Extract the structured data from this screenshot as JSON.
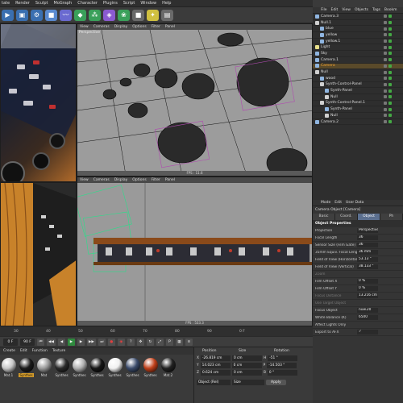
{
  "menu": [
    "tate",
    "Render",
    "Sculpt",
    "MoGraph",
    "Character",
    "Plugins",
    "Script",
    "Window",
    "Help"
  ],
  "toolbar": {
    "icons": [
      "render-icon",
      "render-region-icon",
      "render-settings-icon",
      "cube-icon",
      "spline-icon",
      "nurbs-icon",
      "array-icon",
      "deformer-icon",
      "scene-icon",
      "camera-icon",
      "light-icon",
      "display-icon"
    ]
  },
  "viewport_top": {
    "menu": [
      "View",
      "Cameras",
      "Display",
      "Options",
      "Filter",
      "Panel"
    ],
    "label": "Perspective",
    "fps": "FPS : 11.6"
  },
  "viewport_bottom": {
    "menu": [
      "View",
      "Cameras",
      "Display",
      "Options",
      "Filter",
      "Panel"
    ],
    "fps": "FPS : 533.3"
  },
  "object_manager": {
    "menu": [
      "File",
      "Edit",
      "View",
      "Objects",
      "Tags",
      "Bookm"
    ],
    "items": [
      {
        "name": "Camera.3",
        "indent": 0,
        "color": "#8fb5e0"
      },
      {
        "name": "Null.1",
        "indent": 0,
        "color": "#d0d0d0"
      },
      {
        "name": "blue",
        "indent": 1,
        "color": "#8fb5e0"
      },
      {
        "name": "yellow",
        "indent": 1,
        "color": "#8fb5e0"
      },
      {
        "name": "yellow.1",
        "indent": 1,
        "color": "#8fb5e0"
      },
      {
        "name": "Light",
        "indent": 0,
        "color": "#e8e08a"
      },
      {
        "name": "Sky",
        "indent": 0,
        "color": "#8fb5e0"
      },
      {
        "name": "Camera.1",
        "indent": 0,
        "color": "#8fb5e0"
      },
      {
        "name": "Camera",
        "indent": 0,
        "color": "#8fb5e0",
        "highlight": true
      },
      {
        "name": "Null",
        "indent": 0,
        "color": "#d0d0d0"
      },
      {
        "name": "wood",
        "indent": 1,
        "color": "#8fb5e0"
      },
      {
        "name": "Synth-Control-Panel",
        "indent": 1,
        "color": "#d0d0d0"
      },
      {
        "name": "Synth-Panel",
        "indent": 2,
        "color": "#8fb5e0"
      },
      {
        "name": "Null",
        "indent": 2,
        "color": "#d0d0d0"
      },
      {
        "name": "Synth-Control-Panel.1",
        "indent": 1,
        "color": "#d0d0d0"
      },
      {
        "name": "Synth-Panel",
        "indent": 2,
        "color": "#8fb5e0"
      },
      {
        "name": "Null",
        "indent": 2,
        "color": "#d0d0d0"
      },
      {
        "name": "Camera.2",
        "indent": 0,
        "color": "#8fb5e0"
      }
    ]
  },
  "attributes": {
    "menu": [
      "Mode",
      "Edit",
      "User Data"
    ],
    "object_title": "Camera Object [Camera]",
    "tabs": [
      "Basic",
      "Coord.",
      "Object",
      "Ph"
    ],
    "active_tab": "Object",
    "section": "Object Properties",
    "rows": [
      {
        "label": "Projection",
        "value": "Perspective",
        "dim": false
      },
      {
        "label": "Focal Length",
        "value": "36",
        "dim": false
      },
      {
        "label": "Sensor Size (Film Gate)",
        "value": "36",
        "dim": false
      },
      {
        "label": "35mm Equiv. Focal Length:",
        "value": "36 mm",
        "dim": false
      },
      {
        "label": "Field of View (Horizontal)",
        "value": "53.13 °",
        "dim": false
      },
      {
        "label": "Field of View (Vertical)",
        "value": "38.133 °",
        "dim": false
      },
      {
        "label": "Zoom",
        "value": "",
        "dim": true
      },
      {
        "label": "Film Offset X",
        "value": "0 %",
        "dim": false
      },
      {
        "label": "Film Offset Y",
        "value": "0 %",
        "dim": false
      },
      {
        "label": "Focus Distance",
        "value": "13.216 cm",
        "dim": true
      },
      {
        "label": "Use Target Object",
        "value": "",
        "dim": true
      },
      {
        "label": "Focus Object",
        "value": "nuw.20",
        "dim": false
      },
      {
        "label": "White Balance (K)",
        "value": "6500",
        "dim": false
      },
      {
        "label": "Affect Lights Only",
        "value": "",
        "dim": false
      },
      {
        "label": "Export to AFX",
        "value": "✓",
        "dim": false
      }
    ]
  },
  "timeline": {
    "ticks": [
      "30",
      "40",
      "50",
      "60",
      "70",
      "80",
      "90"
    ],
    "end": "0 F"
  },
  "playback": {
    "current_frame": "90 F"
  },
  "materials": {
    "menu": [
      "Create",
      "Edit",
      "Function",
      "Texture"
    ],
    "items": [
      {
        "label": "Mat.1",
        "color": "#c8c8c8",
        "selected": false
      },
      {
        "label": "Synthes",
        "color": "#1a1a1a",
        "selected": true
      },
      {
        "label": "Mat",
        "color": "#9a9a9a",
        "selected": false
      },
      {
        "label": "Synthes",
        "color": "#2a2a2a",
        "selected": false
      },
      {
        "label": "Synthes",
        "color": "#b0b0b0",
        "selected": false
      },
      {
        "label": "Synthes",
        "color": "#151515",
        "selected": false
      },
      {
        "label": "Synthes",
        "color": "#f0f0f0",
        "selected": false
      },
      {
        "label": "Synthes",
        "color": "#3a4a6a",
        "selected": false
      },
      {
        "label": "Synthes",
        "color": "#c0401a",
        "selected": false
      },
      {
        "label": "Mat.2",
        "color": "#222222",
        "selected": false
      }
    ]
  },
  "coordinates": {
    "headers": [
      "Position",
      "Size",
      "Rotation"
    ],
    "rows": [
      {
        "axis": "X",
        "pos": "-26.819 cm",
        "size": "0 cm",
        "rot_axis": "H",
        "rot": "-51 °"
      },
      {
        "axis": "Y",
        "pos": "14.023 cm",
        "size": "0 cm",
        "rot_axis": "P",
        "rot": "-14.503 °"
      },
      {
        "axis": "Z",
        "pos": "0.624 cm",
        "size": "0 cm",
        "rot_axis": "B",
        "rot": "0 °"
      }
    ],
    "mode": "Object (Rel)",
    "size_mode": "Size",
    "apply": "Apply"
  }
}
